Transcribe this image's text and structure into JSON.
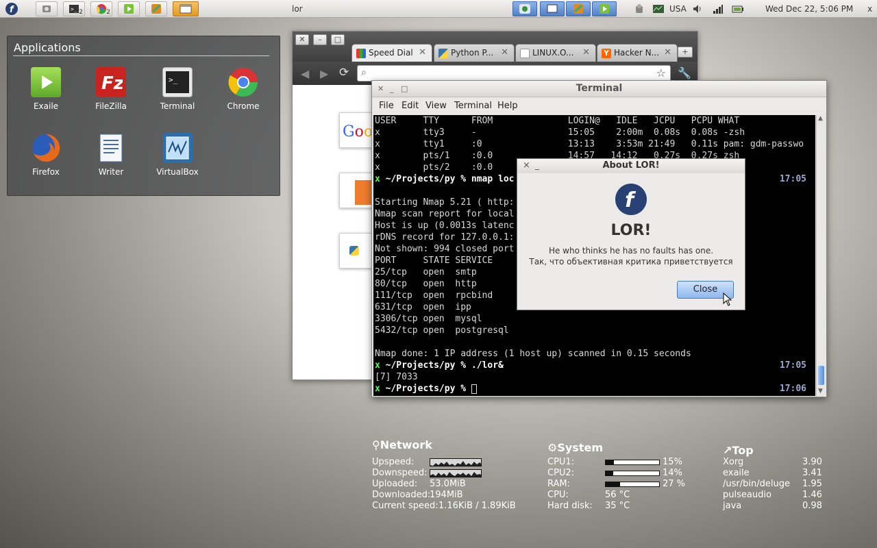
{
  "top_panel": {
    "window_title": "lor",
    "keyboard_layout": "USA",
    "clock": "Wed Dec 22,  5:06 PM",
    "close_glyph": "x",
    "task_buttons": [
      {
        "name": "fedora-menu-icon"
      },
      {
        "name": "screenshot-icon"
      },
      {
        "name": "terminal-group-icon",
        "count": "2"
      },
      {
        "name": "chrome-group-icon",
        "count": "2"
      },
      {
        "name": "exaile-icon"
      },
      {
        "name": "lor-app-icon"
      },
      {
        "name": "window-icon"
      }
    ]
  },
  "applications": {
    "title": "Applications",
    "items": [
      {
        "label": "Exaile",
        "icon": "exaile-icon",
        "color": "#7cc236"
      },
      {
        "label": "FileZilla",
        "icon": "filezilla-icon",
        "color": "#c8231f"
      },
      {
        "label": "Terminal",
        "icon": "terminal-icon",
        "color": "#2b2b2b"
      },
      {
        "label": "Chrome",
        "icon": "chrome-icon",
        "color": "#3a8f3a"
      },
      {
        "label": "Firefox",
        "icon": "firefox-icon",
        "color": "#e46a1c"
      },
      {
        "label": "Writer",
        "icon": "writer-icon",
        "color": "#4a6e9a"
      },
      {
        "label": "VirtualBox",
        "icon": "virtualbox-icon",
        "color": "#3b7fbf"
      }
    ]
  },
  "browser": {
    "tabs": [
      {
        "label": "Speed Dial",
        "active": true
      },
      {
        "label": "Python P..."
      },
      {
        "label": "LINUX.O..."
      },
      {
        "label": "Hacker N..."
      }
    ],
    "omnibox_value": ""
  },
  "terminal": {
    "title": "Terminal",
    "menu": [
      "File",
      "Edit",
      "View",
      "Terminal",
      "Help"
    ],
    "lines": [
      {
        "text": "USER     TTY      FROM              LOGIN@   IDLE   JCPU   PCPU WHAT"
      },
      {
        "text": "x        tty3     -                 15:05    2:00m  0.08s  0.08s -zsh"
      },
      {
        "text": "x        tty1     :0                13:13    3:53m 21:49   0.11s pam: gdm-passwo"
      },
      {
        "text": "x        pts/1    :0.0              14:57   14:12   0.27s  0.27s zsh"
      },
      {
        "text": "x        pts/2    :0.0"
      },
      {
        "text": "~/Projects/py % nmap loc",
        "prompt": true,
        "time": "17:05"
      },
      {
        "text": ""
      },
      {
        "text": "Starting Nmap 5.21 ( http:"
      },
      {
        "text": "Nmap scan report for local"
      },
      {
        "text": "Host is up (0.0013s latenc"
      },
      {
        "text": "rDNS record for 127.0.0.1:"
      },
      {
        "text": "Not shown: 994 closed port"
      },
      {
        "text": "PORT     STATE SERVICE"
      },
      {
        "text": "25/tcp   open  smtp"
      },
      {
        "text": "80/tcp   open  http"
      },
      {
        "text": "111/tcp  open  rpcbind"
      },
      {
        "text": "631/tcp  open  ipp"
      },
      {
        "text": "3306/tcp open  mysql"
      },
      {
        "text": "5432/tcp open  postgresql"
      },
      {
        "text": ""
      },
      {
        "text": "Nmap done: 1 IP address (1 host up) scanned in 0.15 seconds"
      },
      {
        "text": "~/Projects/py % ./lor&",
        "prompt": true,
        "time": "17:05"
      },
      {
        "text": "[7] 7033"
      },
      {
        "text": "~/Projects/py % ",
        "prompt": true,
        "time": "17:06",
        "cursor": true
      }
    ],
    "prompt_user": "x"
  },
  "about_dialog": {
    "title": "About LOR!",
    "app_name": "LOR!",
    "comment_line1": "He who thinks he has no faults has one.",
    "comment_line2": "Так, что объективная критика приветствуется",
    "close_label": "Close",
    "close_glyph": "×",
    "minimize_glyph": "_"
  },
  "conky": {
    "network": {
      "title": "Network",
      "rows": [
        {
          "label": "Upspeed:",
          "graph": true
        },
        {
          "label": "Downspeed:",
          "graph": true
        },
        {
          "label": "Uploaded:",
          "value": "53.0MiB"
        },
        {
          "label": "Downloaded:",
          "value": "194MiB"
        },
        {
          "label": "Current speed:",
          "value": "1.16KiB / 1.89KiB"
        }
      ]
    },
    "system": {
      "title": "System",
      "rows": [
        {
          "label": "CPU1:",
          "bar": 0.15,
          "value": "15%"
        },
        {
          "label": "CPU2:",
          "bar": 0.14,
          "value": "14%"
        },
        {
          "label": "RAM:",
          "bar": 0.27,
          "value": "27 %"
        },
        {
          "label": "CPU:",
          "value": "56 °C"
        },
        {
          "label": "Hard disk:",
          "value": "35 °C"
        }
      ]
    },
    "top": {
      "title": "Top",
      "rows": [
        {
          "name": "Xorg",
          "value": "3.90"
        },
        {
          "name": "exaile",
          "value": "3.41"
        },
        {
          "name": "/usr/bin/deluge",
          "value": "1.95"
        },
        {
          "name": "pulseaudio",
          "value": "1.46"
        },
        {
          "name": "java",
          "value": "0.98"
        }
      ]
    }
  }
}
